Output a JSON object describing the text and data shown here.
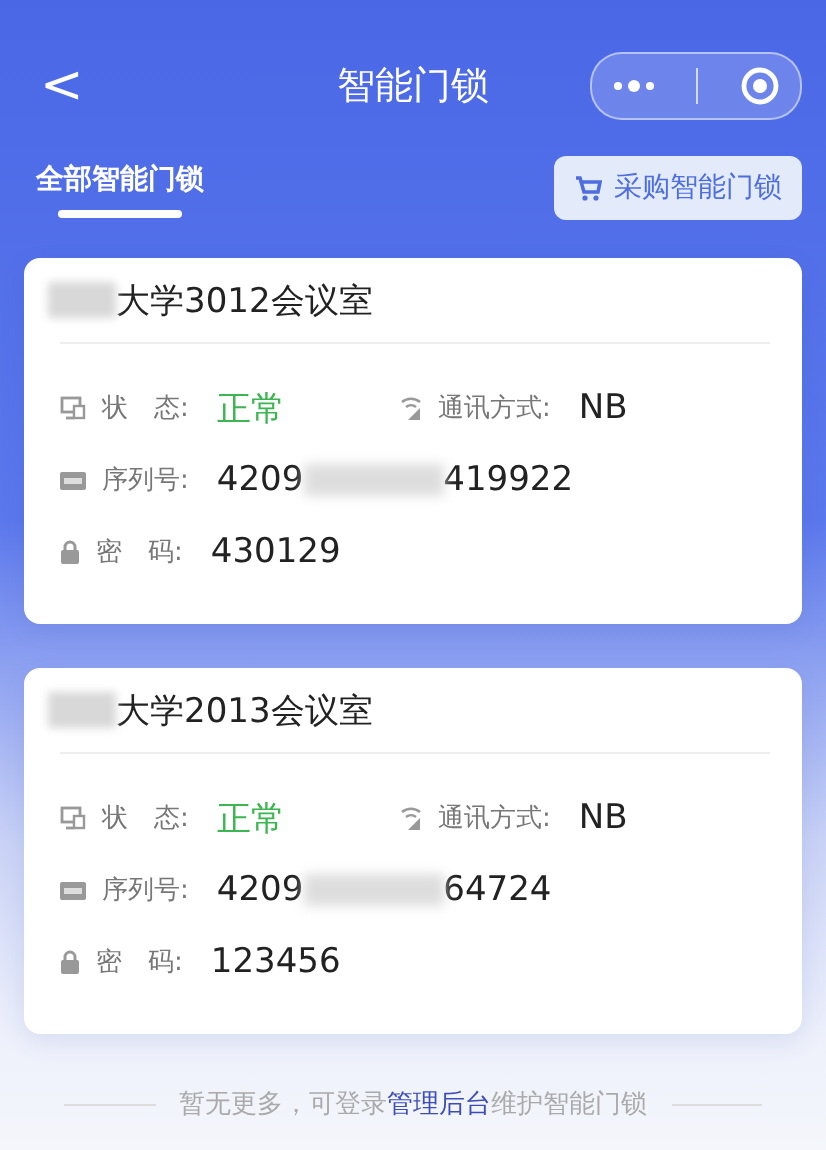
{
  "nav_bar": {
    "back": "<",
    "title": "智能门锁"
  },
  "tabs": [
    {
      "label": "全部智能门锁",
      "selected": true
    }
  ],
  "buy_button": {
    "label": "采购智能门锁"
  },
  "locks": [
    {
      "name": "大学3012会议室",
      "name_redacted": true,
      "status_label": "状　态:",
      "status": "正常",
      "status_ok": true,
      "comm_label": "通讯方式:",
      "comm": "NB",
      "serial_label": "序列号:",
      "serial_head": "4209",
      "serial_tail": "419922",
      "password_label": "密　码:",
      "password": "430129"
    },
    {
      "name": "大学2013会议室",
      "name_redacted": true,
      "status_label": "状　态:",
      "status": "正常",
      "status_ok": true,
      "comm_label": "通讯方式:",
      "comm": "NB",
      "serial_label": "序列号:",
      "serial_head": "4209",
      "serial_tail": "64724",
      "password_label": "密　码:",
      "password": "123456"
    }
  ],
  "footer": {
    "before": "暂无更多，可登录",
    "link": "管理后台",
    "after": "维护智能门锁"
  }
}
